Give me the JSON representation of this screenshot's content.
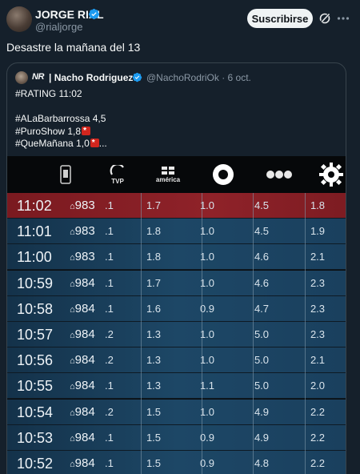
{
  "author": {
    "name": "JORGE RIAL",
    "handle": "@rialjorge",
    "subscribe_label": "Suscribirse"
  },
  "tweet": {
    "text": "Desastre la mañana del 13"
  },
  "quote": {
    "logo": "NR",
    "name": "| Nacho Rodriguez",
    "handle_date": "@NachoRodriOk · 6 oct.",
    "lines": [
      "#RATING 11:02",
      "",
      "#ALaBarbarrossa 4,5",
      "#PuroShow 1,8",
      "#QueMañana 1,0"
    ],
    "more": "..."
  },
  "tv": {
    "channels": [
      {
        "name": "phone-channel-icon",
        "label": ""
      },
      {
        "name": "tvp-logo",
        "label": "TVP"
      },
      {
        "name": "america-logo",
        "label": "américa"
      },
      {
        "name": "telefe-logo",
        "label": ""
      },
      {
        "name": "el-trece-logo",
        "label": ""
      },
      {
        "name": "nueve-logo",
        "label": ""
      }
    ],
    "rows": [
      {
        "time": "11:02",
        "house": "983",
        "c1": ".1",
        "c2": "1.7",
        "c3": "1.0",
        "c4": "4.5",
        "c5": "1.8"
      },
      {
        "time": "11:01",
        "house": "983",
        "c1": ".1",
        "c2": "1.8",
        "c3": "1.0",
        "c4": "4.5",
        "c5": "1.9"
      },
      {
        "time": "11:00",
        "house": "983",
        "c1": ".1",
        "c2": "1.8",
        "c3": "1.0",
        "c4": "4.6",
        "c5": "2.1"
      },
      {
        "time": "10:59",
        "house": "984",
        "c1": ".1",
        "c2": "1.7",
        "c3": "1.0",
        "c4": "4.6",
        "c5": "2.3"
      },
      {
        "time": "10:58",
        "house": "984",
        "c1": ".1",
        "c2": "1.6",
        "c3": "0.9",
        "c4": "4.7",
        "c5": "2.3"
      },
      {
        "time": "10:57",
        "house": "984",
        "c1": ".2",
        "c2": "1.3",
        "c3": "1.0",
        "c4": "5.0",
        "c5": "2.3"
      },
      {
        "time": "10:56",
        "house": "984",
        "c1": ".2",
        "c2": "1.3",
        "c3": "1.0",
        "c4": "5.0",
        "c5": "2.1"
      },
      {
        "time": "10:55",
        "house": "984",
        "c1": ".1",
        "c2": "1.3",
        "c3": "1.1",
        "c4": "5.0",
        "c5": "2.0"
      },
      {
        "time": "10:54",
        "house": "984",
        "c1": ".2",
        "c2": "1.5",
        "c3": "1.0",
        "c4": "4.9",
        "c5": "2.2"
      },
      {
        "time": "10:53",
        "house": "984",
        "c1": ".1",
        "c2": "1.5",
        "c3": "0.9",
        "c4": "4.9",
        "c5": "2.2"
      },
      {
        "time": "10:52",
        "house": "984",
        "c1": ".1",
        "c2": "1.5",
        "c3": "0.9",
        "c4": "4.8",
        "c5": "2.2"
      }
    ]
  }
}
